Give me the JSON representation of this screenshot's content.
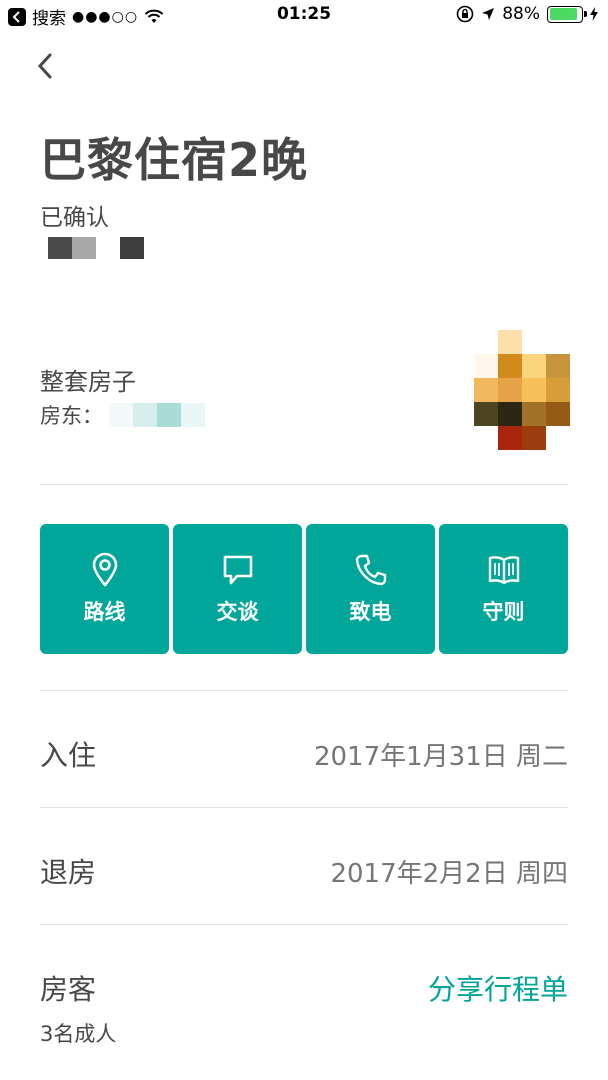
{
  "status_bar": {
    "back_app_label": "搜索",
    "signal": "●●●○○",
    "time": "01:25",
    "battery_percent": "88%",
    "battery_level": 0.88,
    "battery_color": "#4cd964"
  },
  "trip": {
    "title": "巴黎住宿2晚",
    "status": "已确认"
  },
  "listing": {
    "type": "整套房子",
    "host_label": "房东："
  },
  "actions": [
    {
      "label": "路线",
      "icon": "map-pin-icon"
    },
    {
      "label": "交谈",
      "icon": "chat-bubble-icon"
    },
    {
      "label": "致电",
      "icon": "phone-icon"
    },
    {
      "label": "守则",
      "icon": "open-book-icon"
    }
  ],
  "checkin": {
    "label": "入住",
    "value": "2017年1月31日 周二"
  },
  "checkout": {
    "label": "退房",
    "value": "2017年2月2日 周四"
  },
  "guests": {
    "label": "房客",
    "share_link": "分享行程单",
    "count": "3名成人"
  },
  "colors": {
    "accent": "#00a699",
    "text": "#484848",
    "muted": "#767676",
    "divider": "#e4e4e4"
  }
}
